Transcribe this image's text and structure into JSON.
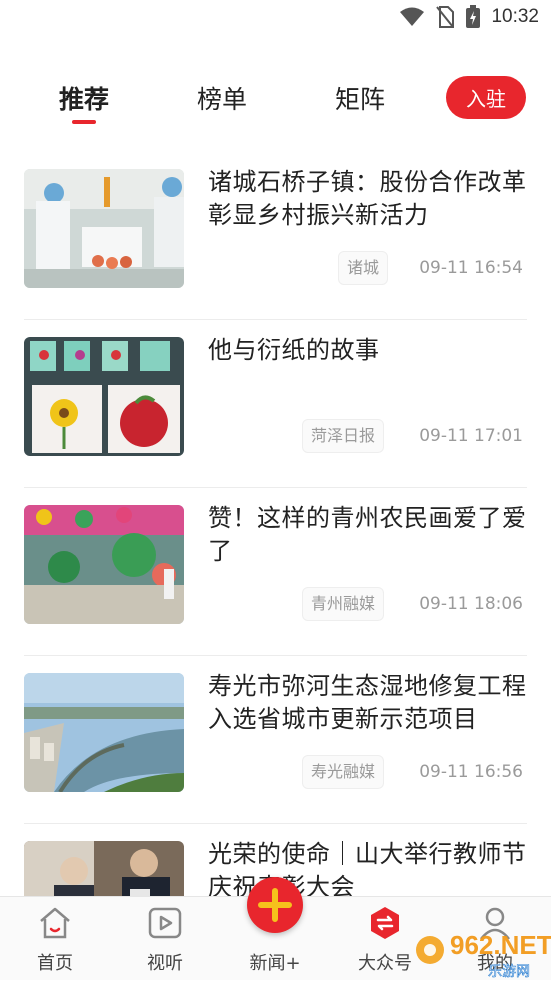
{
  "status_bar": {
    "time": "10:32"
  },
  "tabs": [
    {
      "label": "推荐"
    },
    {
      "label": "榜单"
    },
    {
      "label": "矩阵"
    }
  ],
  "join_button": "入驻",
  "news": [
    {
      "title": "诸城石桥子镇：股份合作改革彰显乡村振兴新活力",
      "source": "诸城",
      "time": "09-11 16:54"
    },
    {
      "title": "他与衍纸的故事",
      "source": "菏泽日报",
      "time": "09-11 17:01"
    },
    {
      "title": "赞！这样的青州农民画爱了爱了",
      "source": "青州融媒",
      "time": "09-11 18:06"
    },
    {
      "title": "寿光市弥河生态湿地修复工程入选省城市更新示范项目",
      "source": "寿光融媒",
      "time": "09-11 16:56"
    },
    {
      "title": "光荣的使命｜山大举行教师节庆祝表彰大会",
      "source": "",
      "time": ""
    }
  ],
  "bottom_nav": [
    {
      "label": "首页",
      "icon": "home-icon"
    },
    {
      "label": "视听",
      "icon": "video-icon"
    },
    {
      "label": "新闻+",
      "icon": "plus-icon"
    },
    {
      "label": "大众号",
      "icon": "subscription-icon"
    },
    {
      "label": "我的",
      "icon": "user-icon"
    }
  ],
  "watermark": {
    "brand": "962.NET",
    "sub": "乐游网"
  },
  "colors": {
    "accent": "#e8262d",
    "text": "#222222",
    "muted": "#9a9a9a"
  }
}
